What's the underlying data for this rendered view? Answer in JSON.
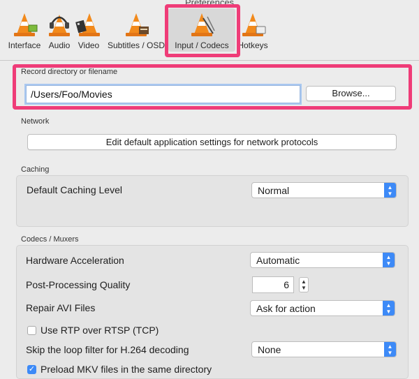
{
  "window": {
    "title": "Preferences"
  },
  "toolbar": {
    "items": [
      {
        "label": "Interface",
        "icon": "cone-interface-icon"
      },
      {
        "label": "Audio",
        "icon": "cone-headphones-icon"
      },
      {
        "label": "Video",
        "icon": "cone-video-icon"
      },
      {
        "label": "Subtitles / OSD",
        "icon": "cone-subtitles-icon"
      },
      {
        "label": "Input / Codecs",
        "icon": "cone-codecs-icon",
        "selected": true
      },
      {
        "label": "Hotkeys",
        "icon": "cone-hotkeys-icon"
      }
    ]
  },
  "record": {
    "label": "Record directory or filename",
    "value": "/Users/Foo/Movies",
    "browse_label": "Browse..."
  },
  "network": {
    "label": "Network",
    "button_label": "Edit default application settings for network protocols"
  },
  "caching": {
    "label": "Caching",
    "level_label": "Default Caching Level",
    "level_value": "Normal"
  },
  "codecs": {
    "label": "Codecs / Muxers",
    "hw_accel_label": "Hardware Acceleration",
    "hw_accel_value": "Automatic",
    "pp_quality_label": "Post-Processing Quality",
    "pp_quality_value": "6",
    "repair_avi_label": "Repair AVI Files",
    "repair_avi_value": "Ask for action",
    "rtp_label": "Use RTP over RTSP (TCP)",
    "rtp_checked": false,
    "loop_filter_label": "Skip the loop filter for H.264 decoding",
    "loop_filter_value": "None",
    "preload_mkv_label": "Preload MKV files in the same directory",
    "preload_mkv_checked": true
  },
  "colors": {
    "highlight": "#ef3c78",
    "accent": "#3d8af7",
    "cone_orange": "#f28a1c"
  }
}
